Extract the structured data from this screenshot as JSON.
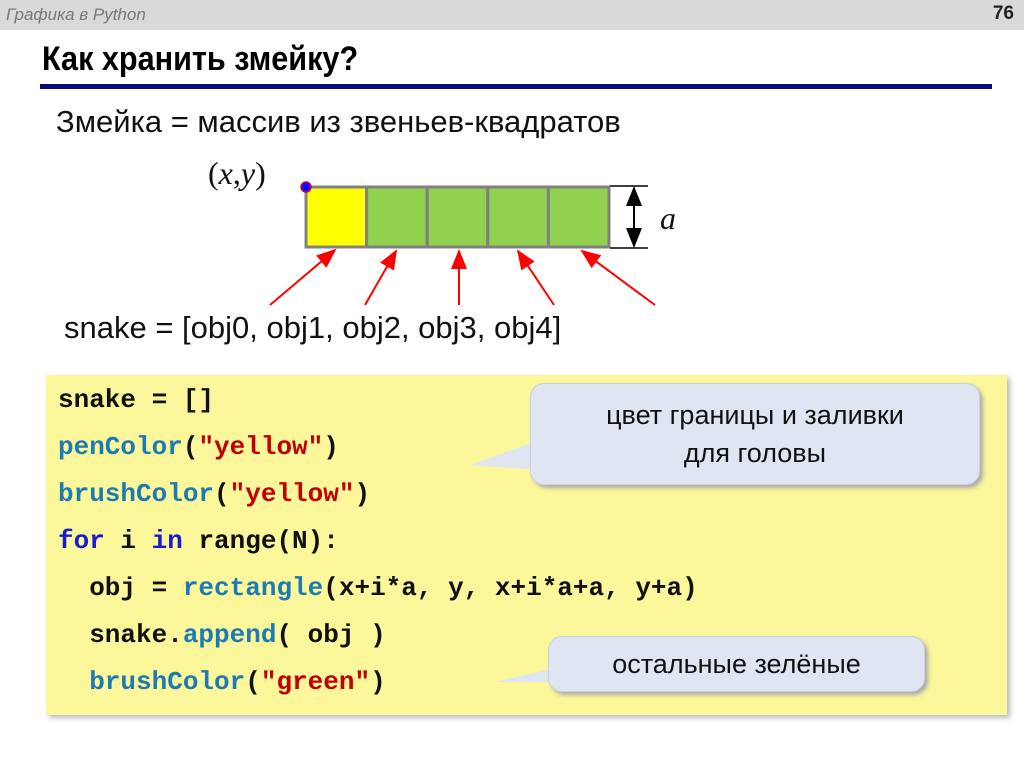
{
  "header": {
    "course": "Графика в Python",
    "page_number": "76"
  },
  "title": "Как хранить змейку?",
  "subtitle": "Змейка = массив из звеньев-квадратов",
  "diagram": {
    "origin_label_open": "(",
    "origin_x": "x",
    "origin_comma": ",",
    "origin_y": "y",
    "origin_close": ")",
    "size_label": "a",
    "segments": [
      "yellow",
      "green",
      "green",
      "green",
      "green"
    ],
    "colors": {
      "head": "#ffff00",
      "body": "#92d050",
      "border": "#808080",
      "arrow": "#ff0000",
      "dot": "#0000ff"
    }
  },
  "list_text": "snake = [obj0, obj1, obj2, obj3, obj4]",
  "code": [
    [
      {
        "t": "n",
        "v": "snake = []"
      }
    ],
    [
      {
        "t": "f",
        "v": "penColor"
      },
      {
        "t": "n",
        "v": "("
      },
      {
        "t": "s",
        "v": "\"yellow\""
      },
      {
        "t": "n",
        "v": ")"
      }
    ],
    [
      {
        "t": "f",
        "v": "brushColor"
      },
      {
        "t": "n",
        "v": "("
      },
      {
        "t": "s",
        "v": "\"yellow\""
      },
      {
        "t": "n",
        "v": ")"
      }
    ],
    [
      {
        "t": "k",
        "v": "for"
      },
      {
        "t": "n",
        "v": " i "
      },
      {
        "t": "k",
        "v": "in"
      },
      {
        "t": "n",
        "v": " range(N):"
      }
    ],
    [
      {
        "t": "n",
        "v": "  obj = "
      },
      {
        "t": "f",
        "v": "rectangle"
      },
      {
        "t": "n",
        "v": "(x+i*a, y, x+i*a+a, y+a)"
      }
    ],
    [
      {
        "t": "n",
        "v": "  snake."
      },
      {
        "t": "f",
        "v": "append"
      },
      {
        "t": "n",
        "v": "( obj )"
      }
    ],
    [
      {
        "t": "n",
        "v": "  "
      },
      {
        "t": "f",
        "v": "brushColor"
      },
      {
        "t": "n",
        "v": "("
      },
      {
        "t": "s",
        "v": "\"green\""
      },
      {
        "t": "n",
        "v": ")"
      }
    ]
  ],
  "callouts": {
    "head": [
      "цвет границы и заливки",
      "для головы"
    ],
    "rest": "остальные зелёные"
  }
}
